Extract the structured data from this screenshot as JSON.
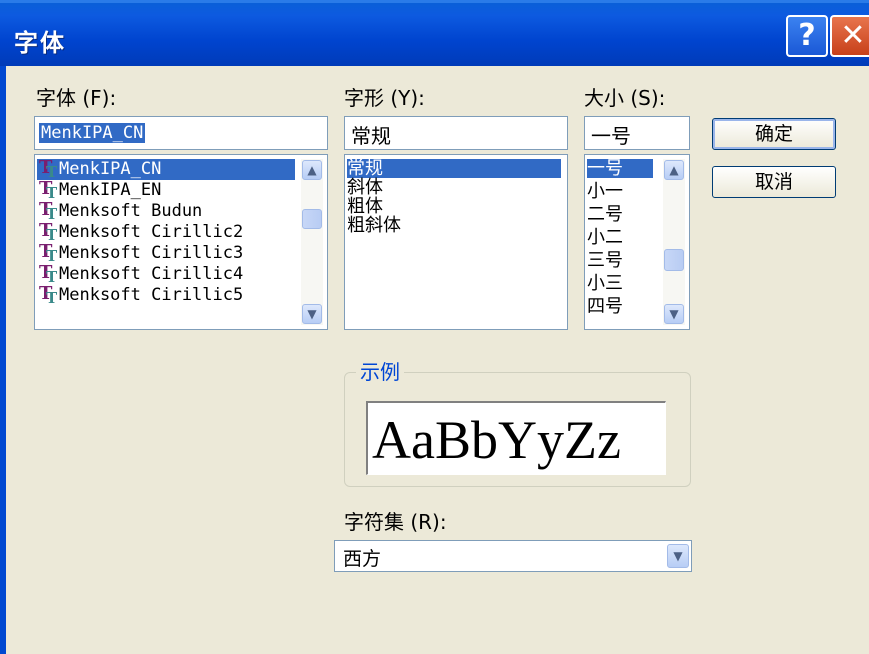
{
  "window": {
    "title": "字体",
    "help_icon": "?",
    "close_icon": "✕"
  },
  "font_name": {
    "label": "字体 (F):",
    "value": "MenkIPA_CN",
    "items": [
      "MenkIPA_CN",
      "MenkIPA_EN",
      "Menksoft Budun",
      "Menksoft Cirillic2",
      "Menksoft Cirillic3",
      "Menksoft Cirillic4",
      "Menksoft Cirillic5"
    ],
    "selected_index": 0
  },
  "font_style": {
    "label": "字形 (Y):",
    "value": "常规",
    "items": [
      "常规",
      "斜体",
      "粗体",
      "粗斜体"
    ],
    "selected_index": 0
  },
  "font_size": {
    "label": "大小 (S):",
    "value": "一号",
    "items": [
      "一号",
      "小一",
      "二号",
      "小二",
      "三号",
      "小三",
      "四号"
    ],
    "selected_index": 0
  },
  "buttons": {
    "ok": "确定",
    "cancel": "取消"
  },
  "sample": {
    "title": "示例",
    "text": "AaBbYyZz"
  },
  "charset": {
    "label": "字符集 (R):",
    "value": "西方"
  },
  "icons": {
    "scroll_up": "▲",
    "scroll_down": "▼",
    "dropdown": "▼"
  },
  "colors": {
    "titlebar": "#0044cf",
    "selection": "#316ac5",
    "dialog_bg": "#ece9d8",
    "group_title": "#0046d5"
  }
}
